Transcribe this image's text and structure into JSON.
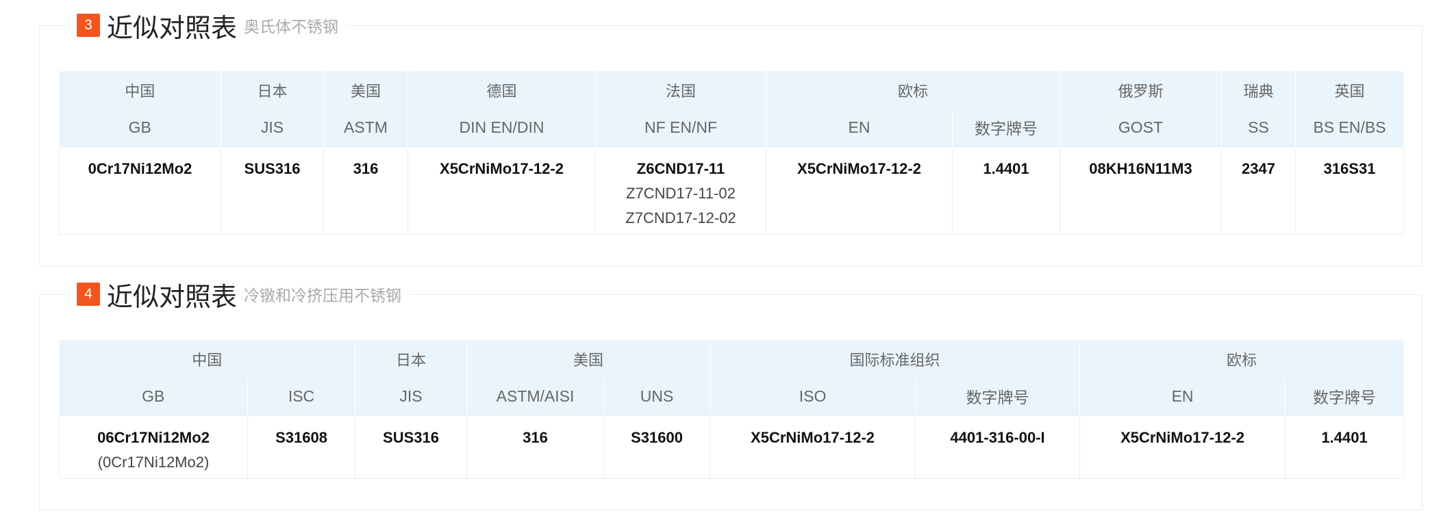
{
  "sections": [
    {
      "number": "3",
      "title": "近似对照表",
      "subtitle": "奥氏体不锈钢",
      "header_groups": [
        "中国",
        "日本",
        "美国",
        "德国",
        "法国",
        "欧标",
        "俄罗斯",
        "瑞典",
        "英国"
      ],
      "columns": [
        "GB",
        "JIS",
        "ASTM",
        "DIN EN/DIN",
        "NF EN/NF",
        "EN",
        "数字牌号",
        "GOST",
        "SS",
        "BS EN/BS"
      ],
      "row": {
        "gb": "0Cr17Ni12Mo2",
        "jis": "SUS316",
        "astm": "316",
        "din": "X5CrNiMo17-12-2",
        "nf_main": "Z6CND17-11",
        "nf_alt1": "Z7CND17-11-02",
        "nf_alt2": "Z7CND17-12-02",
        "en": "X5CrNiMo17-12-2",
        "num": "1.4401",
        "gost": "08KH16N11M3",
        "ss": "2347",
        "bs": "316S31"
      }
    },
    {
      "number": "4",
      "title": "近似对照表",
      "subtitle": "冷镦和冷挤压用不锈钢",
      "header_groups": [
        "中国",
        "日本",
        "美国",
        "国际标准组织",
        "欧标"
      ],
      "columns": [
        "GB",
        "ISC",
        "JIS",
        "ASTM/AISI",
        "UNS",
        "ISO",
        "数字牌号",
        "EN",
        "数字牌号"
      ],
      "row": {
        "gb_main": "06Cr17Ni12Mo2",
        "gb_alt": "(0Cr17Ni12Mo2)",
        "isc": "S31608",
        "jis": "SUS316",
        "astm": "316",
        "uns": "S31600",
        "iso": "X5CrNiMo17-12-2",
        "iso_num": "4401-316-00-I",
        "en": "X5CrNiMo17-12-2",
        "en_num": "1.4401"
      }
    }
  ]
}
